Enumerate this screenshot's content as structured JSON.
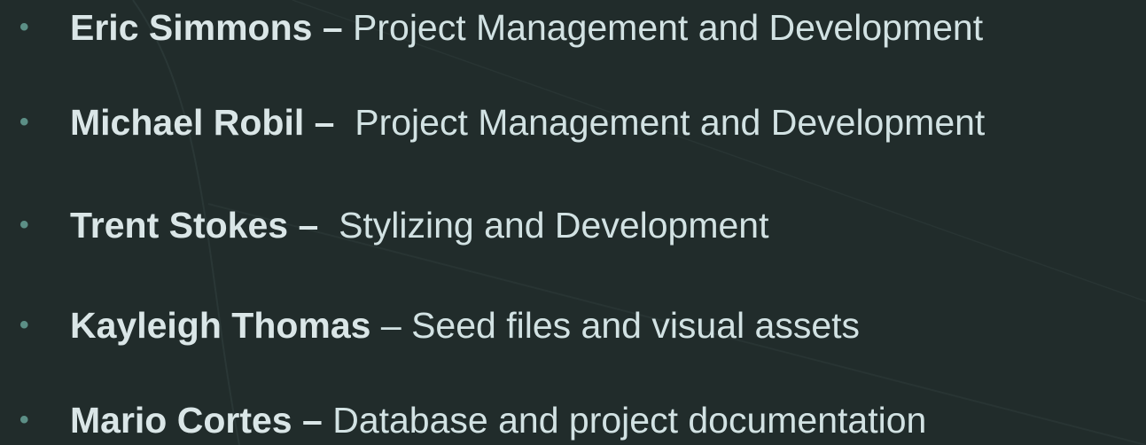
{
  "colors": {
    "background": "#212c2b",
    "text": "#d2e2e3",
    "bullet": "#5c8f86"
  },
  "bullet_icon": "bullet-dot",
  "team": [
    {
      "name": "Eric Simmons –",
      "role": " Project Management and Development"
    },
    {
      "name": "Michael Robil –",
      "role": "  Project Management and Development"
    },
    {
      "name": "Trent Stokes –",
      "role": "  Stylizing and Development"
    },
    {
      "name": "Kayleigh Thomas",
      "role": " – Seed files and visual assets"
    },
    {
      "name": "Mario Cortes –",
      "role": " Database and project documentation"
    }
  ]
}
